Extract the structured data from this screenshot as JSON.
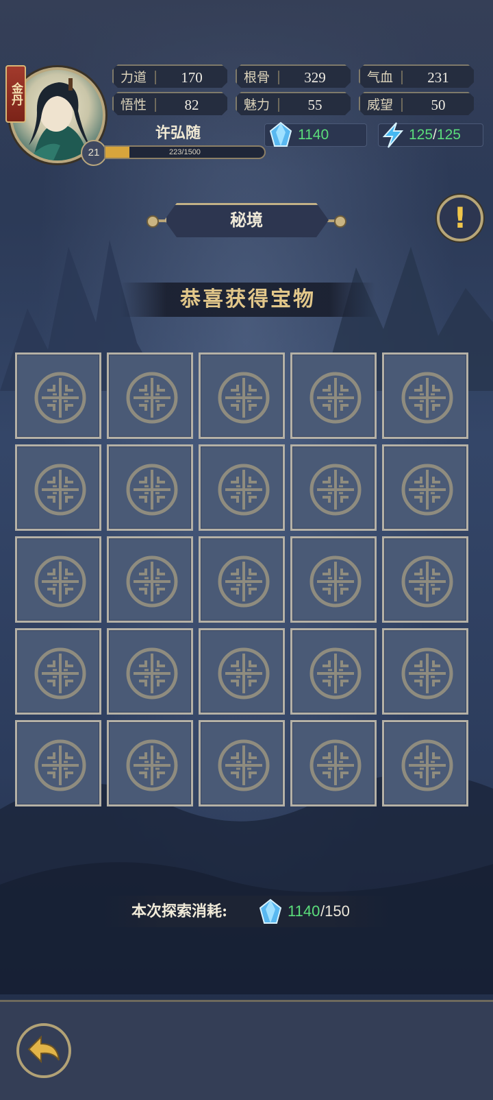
{
  "player": {
    "rank": "金丹",
    "name": "许弘随",
    "level": "21",
    "xp_text": "223/1500",
    "xp_fraction": 0.149
  },
  "stats": [
    {
      "label": "力道",
      "value": "170"
    },
    {
      "label": "根骨",
      "value": "329"
    },
    {
      "label": "气血",
      "value": "231"
    },
    {
      "label": "悟性",
      "value": "82"
    },
    {
      "label": "魅力",
      "value": "55"
    },
    {
      "label": "威望",
      "value": "50"
    }
  ],
  "resources": {
    "crystal": {
      "icon": "blue-crystal-icon",
      "value": "1140"
    },
    "energy": {
      "icon": "lightning-energy-icon",
      "current": "125",
      "slash": "/",
      "max": "125"
    }
  },
  "scene": {
    "title": "秘境",
    "banner": "恭喜获得宝物",
    "info_button": "!"
  },
  "grid": {
    "rows": 5,
    "cols": 5,
    "cell_icon": "ornate-circle-emblem-icon"
  },
  "cost": {
    "label": "本次探索消耗:",
    "have": "1140",
    "need": "/150"
  },
  "nav": {
    "back_icon": "back-arrow-icon"
  },
  "colors": {
    "background": "#2c3a57",
    "gold_border": "#b8a477",
    "green_value": "#5bde7b",
    "cell_fill": "#4a5a76",
    "banner_text": "#e2c78a"
  }
}
